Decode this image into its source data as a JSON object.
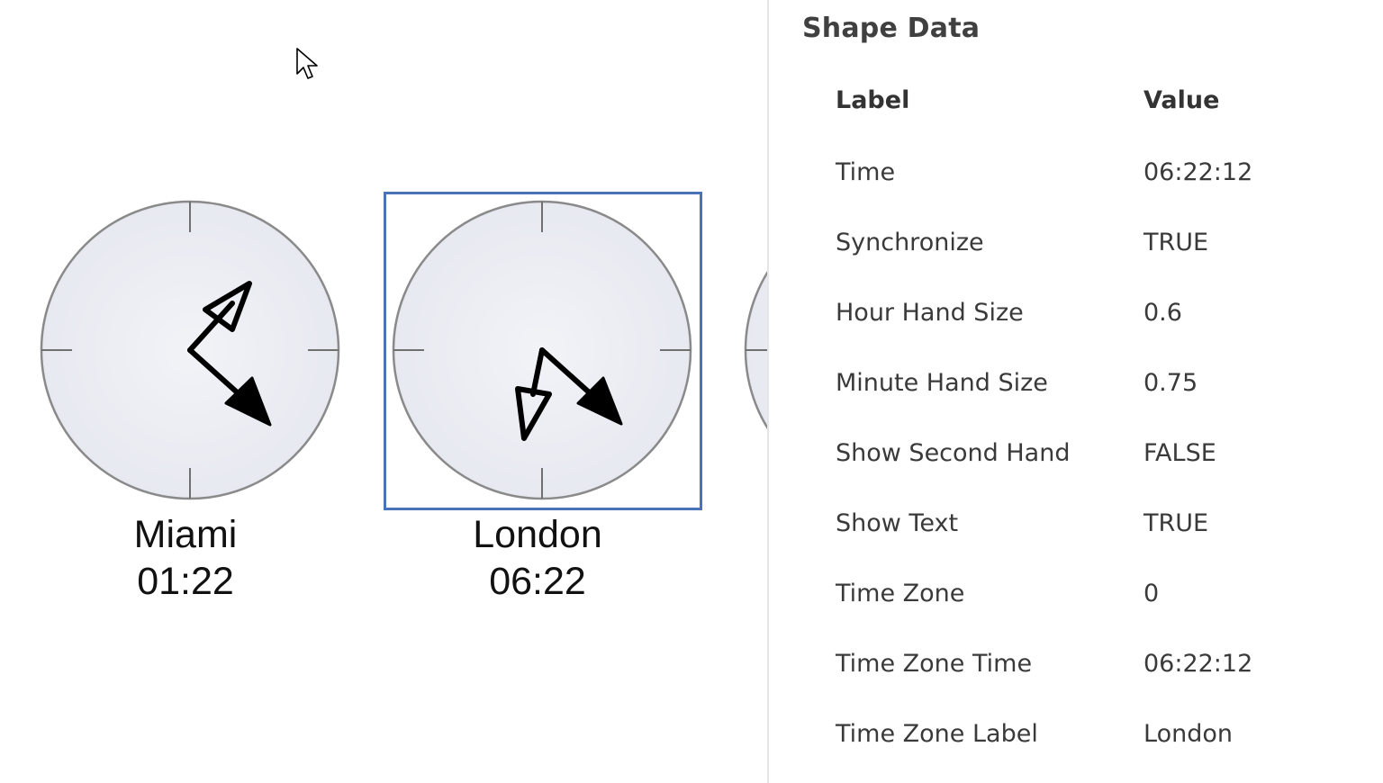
{
  "canvas": {
    "clocks": [
      {
        "city": "Miami",
        "time": "01:22"
      },
      {
        "city": "London",
        "time": "06:22"
      }
    ]
  },
  "shape_data": {
    "title": "Shape Data",
    "header_label": "Label",
    "header_value": "Value",
    "rows": [
      {
        "label": "Time",
        "value": "06:22:12"
      },
      {
        "label": "Synchronize",
        "value": "TRUE"
      },
      {
        "label": "Hour Hand Size",
        "value": "0.6"
      },
      {
        "label": "Minute Hand Size",
        "value": "0.75"
      },
      {
        "label": "Show Second Hand",
        "value": "FALSE"
      },
      {
        "label": "Show Text",
        "value": "TRUE"
      },
      {
        "label": "Time Zone",
        "value": "0"
      },
      {
        "label": "Time Zone Time",
        "value": "06:22:12"
      },
      {
        "label": "Time Zone Label",
        "value": "London"
      }
    ]
  },
  "colors": {
    "clock_face": "#e8eaf2",
    "clock_rim": "#8a8a8a",
    "hands": "#000000",
    "selection": "#4a72b8"
  }
}
